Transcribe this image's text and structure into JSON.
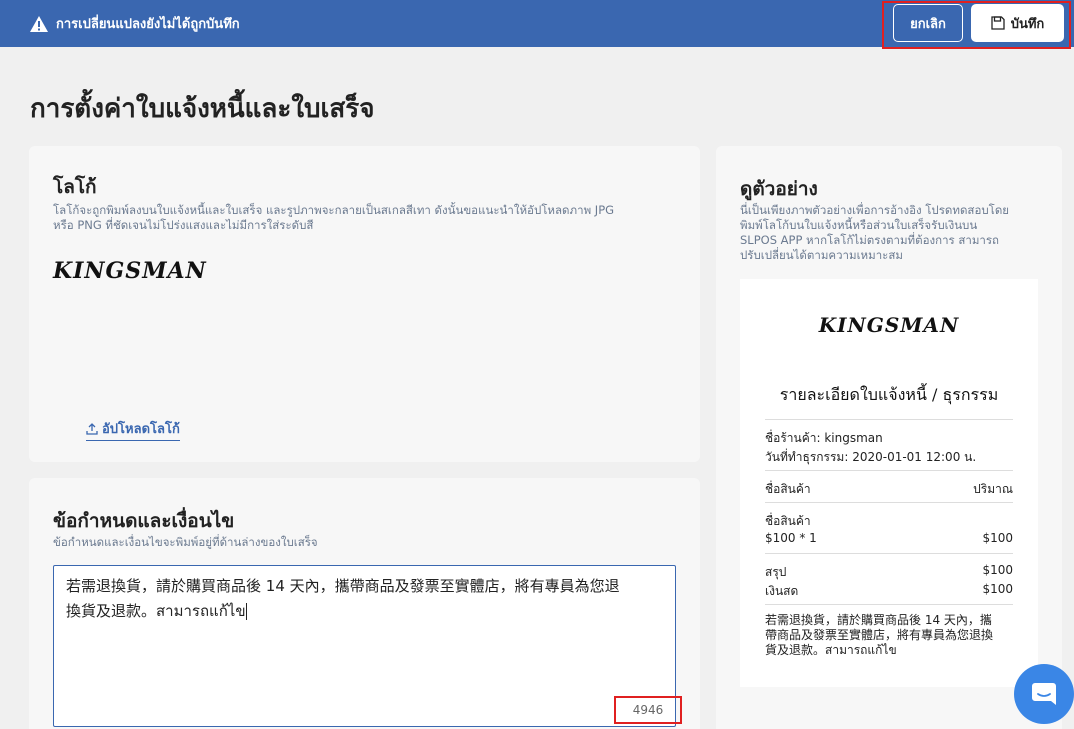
{
  "topbar": {
    "warning_text": "การเปลี่ยนแปลงยังไม่ได้ถูกบันทึก",
    "cancel_label": "ยกเลิก",
    "save_label": "บันทึก",
    "bg_color": "#3a67b0"
  },
  "page": {
    "title": "การตั้งค่าใบแจ้งหนี้และใบเสร็จ"
  },
  "logo_section": {
    "title": "โลโก้",
    "description_line1": "โลโก้จะถูกพิมพ์ลงบนใบแจ้งหนี้และใบเสร็จ และรูปภาพจะกลายเป็นสเกลสีเทา ดังนั้นขอแนะนำให้อัปโหลดภาพ JPG",
    "description_line2": "หรือ PNG ที่ชัดเจนไม่โปร่งแสงและไม่มีการใส่ระดับสี",
    "logo_text": "KINGSMAN",
    "upload_label": "อัปโหลดโลโก้"
  },
  "terms_section": {
    "title": "ข้อกำหนดและเงื่อนไข",
    "description": "ข้อกำหนดและเงื่อนไขจะพิมพ์อยู่ที่ด้านล่างของใบเสร็จ",
    "text_line1": "若需退換貨，請於購買商品後 14 天內，攜帶商品及發票至實體店，將有專員為您退",
    "text_line2": "換貨及退款。สามารถแก้ไข",
    "char_count": "4946"
  },
  "preview_section": {
    "title": "ดูตัวอย่าง",
    "description_line1": "นี่เป็นเพียงภาพตัวอย่างเพื่อการอ้างอิง โปรดทดสอบโดย",
    "description_line2": "พิมพ์โลโก้บนใบแจ้งหนี้หรือส่วนใบเสร็จรับเงินบน",
    "description_line3": "SLPOS APP หากโลโก้ไม่ตรงตามที่ต้องการ สามารถ",
    "description_line4": "ปรับเปลี่ยนได้ตามความเหมาะสม",
    "receipt": {
      "logo_text": "KINGSMAN",
      "title": "รายละเอียดใบแจ้งหนี้ / ธุรกรรม",
      "store_name": "ชื่อร้านค้า: kingsman",
      "date": "วันที่ทำธุรกรรม: 2020-01-01 12:00 น.",
      "col_item": "ชื่อสินค้า",
      "col_qty": "ปริมาณ",
      "item_name": "ชื่อสินค้า",
      "item_price_qty": "$100 * 1",
      "item_total": "$100",
      "summary_label": "สรุป",
      "summary_value": "$100",
      "cash_label": "เงินสด",
      "cash_value": "$100",
      "note_line1": "若需退換貨，請於購買商品後 14 天內，攜",
      "note_line2": "帶商品及發票至實體店，將有專員為您退換",
      "note_line3": "貨及退款。สามารถแก้ไข"
    }
  },
  "chat": {
    "icon": "chat-bubble-icon",
    "color": "#3a86e6"
  }
}
